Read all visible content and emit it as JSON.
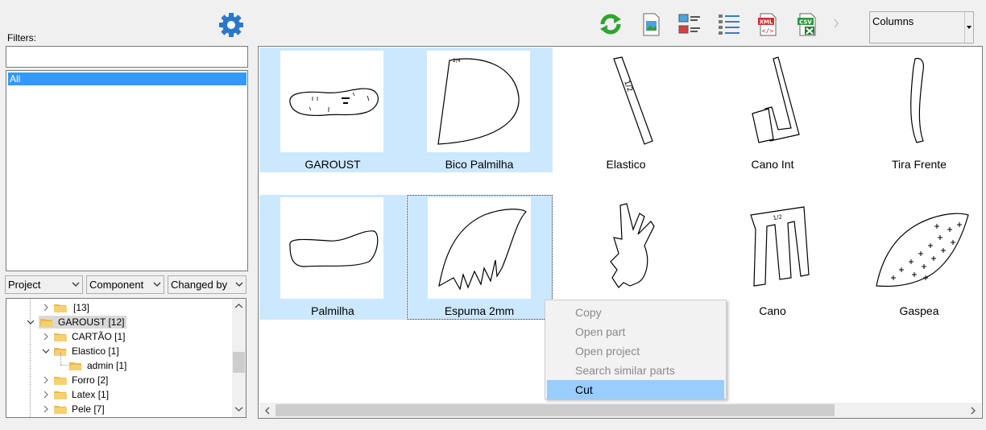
{
  "filters": {
    "label": "Filters:",
    "input_value": "",
    "list": [
      "All"
    ]
  },
  "columns_select": {
    "value": "Columns"
  },
  "filter_combos": [
    "Project",
    "Component",
    "Changed by"
  ],
  "tree": {
    "items": [
      {
        "label": "[13]"
      },
      {
        "label": "GAROUST [12]"
      },
      {
        "label": "CARTÃO [1]"
      },
      {
        "label": "Elastico [1]"
      },
      {
        "label": "admin [1]"
      },
      {
        "label": "Forro [2]"
      },
      {
        "label": "Latex [1]"
      },
      {
        "label": "Pele [7]"
      }
    ]
  },
  "tiles": [
    {
      "name": "GAROUST"
    },
    {
      "name": "Bico Palmilha"
    },
    {
      "name": "Elastico"
    },
    {
      "name": "Cano Int"
    },
    {
      "name": "Tira Frente"
    },
    {
      "name": "Palmilha"
    },
    {
      "name": "Espuma 2mm"
    },
    {
      "name": ""
    },
    {
      "name": "Cano"
    },
    {
      "name": "Gaspea"
    }
  ],
  "context_menu": {
    "items": [
      "Copy",
      "Open part",
      "Open project",
      "Search similar parts",
      "Cut"
    ]
  },
  "icons": {
    "settings": "gear-icon",
    "refresh": "refresh-icon",
    "image": "image-view-icon",
    "list_thumbs": "list-thumbnail-icon",
    "details": "details-list-icon",
    "xml": "xml-export-icon",
    "csv": "csv-export-icon"
  },
  "colors": {
    "selection": "#cce8ff",
    "list_highlight": "#3399ff",
    "menu_active": "#99ccff"
  }
}
